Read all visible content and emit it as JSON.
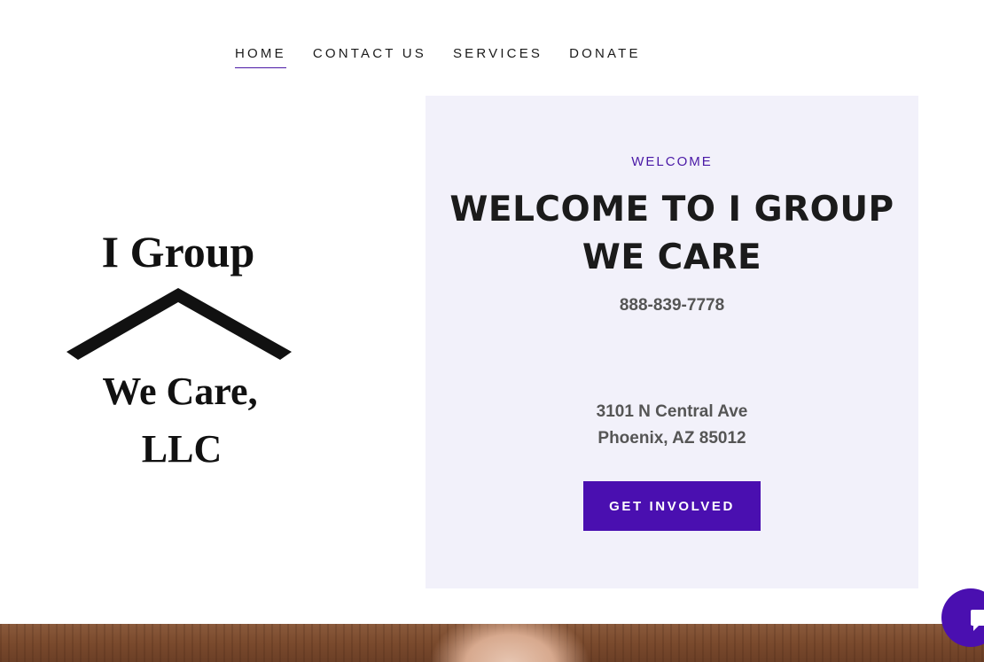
{
  "nav": {
    "items": [
      {
        "label": "HOME",
        "active": true
      },
      {
        "label": "CONTACT US",
        "active": false
      },
      {
        "label": "SERVICES",
        "active": false
      },
      {
        "label": "DONATE",
        "active": false
      }
    ]
  },
  "logo": {
    "line1": "I Group",
    "line2": "We Care,",
    "line3": "LLC"
  },
  "hero": {
    "eyebrow": "WELCOME",
    "headline_line1": "WELCOME TO I GROUP",
    "headline_line2": "WE CARE",
    "phone": "888-839-7778",
    "address_line1": "3101 N Central Ave",
    "address_line2": "Phoenix, AZ 85012",
    "cta_label": "GET INVOLVED"
  },
  "chat": {
    "icon": "chat-icon"
  },
  "colors": {
    "accent": "#4a0fb0",
    "panel": "#f2f1fa",
    "eyebrow": "#4a19a6"
  }
}
